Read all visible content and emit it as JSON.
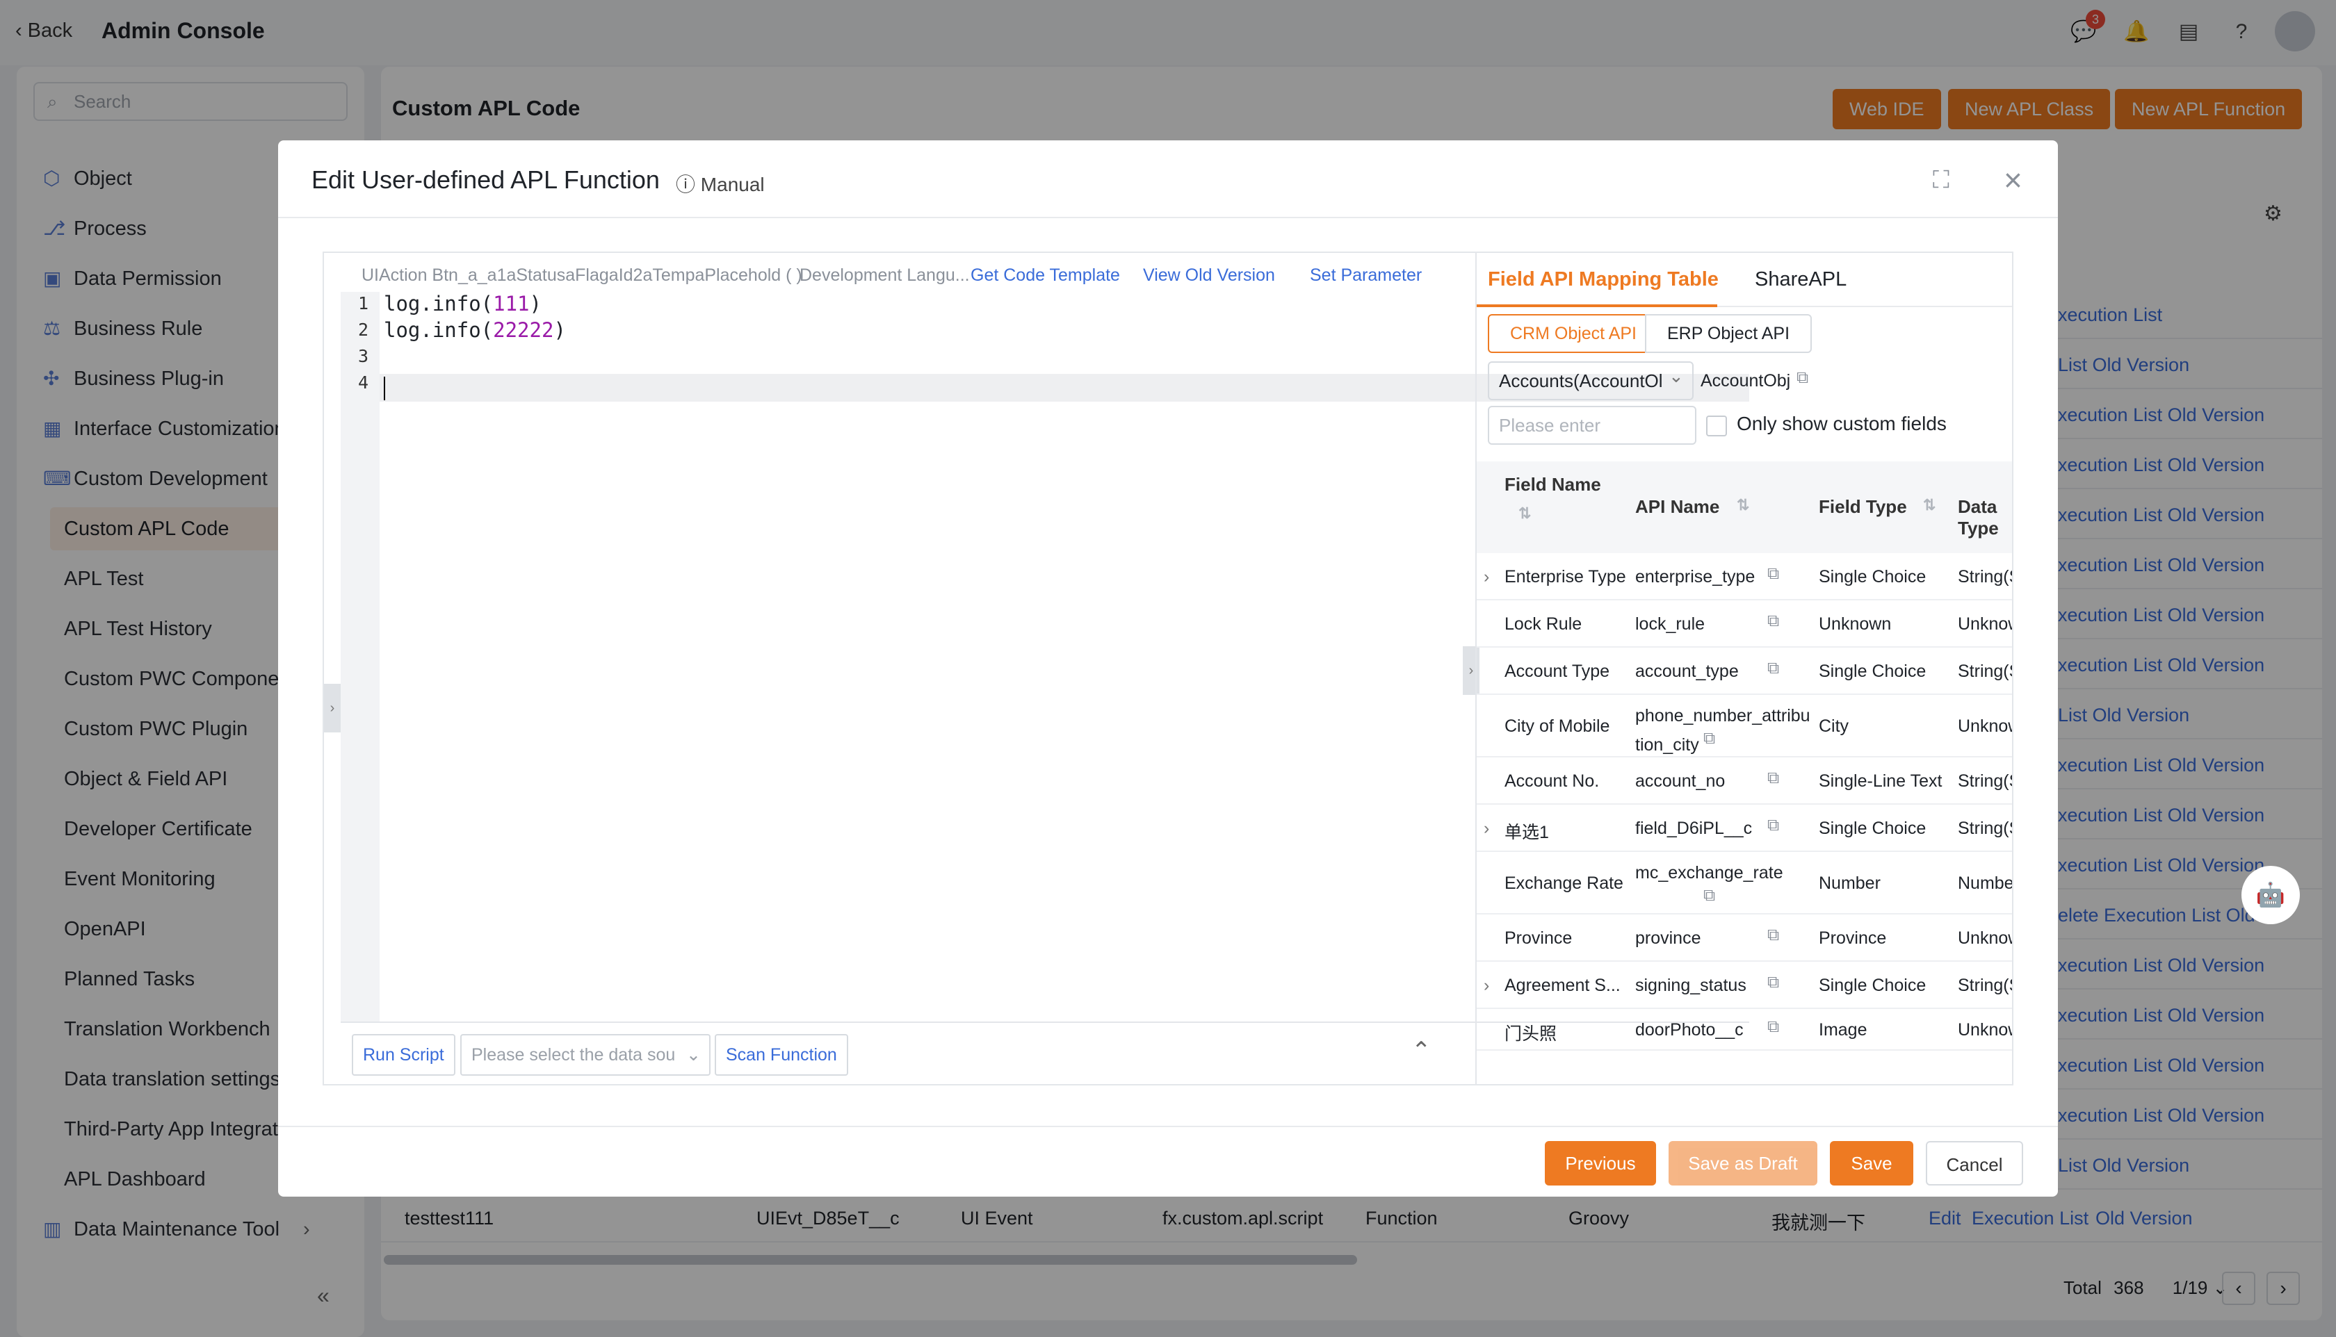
{
  "topbar": {
    "back_label": "Back",
    "title": "Admin Console",
    "chat_badge": "3",
    "icons": [
      "chat-icon",
      "bell-icon",
      "inbox-icon",
      "help-icon",
      "avatar"
    ]
  },
  "sidebar": {
    "search_placeholder": "Search",
    "items": [
      {
        "label": "Object",
        "icon": "cube-icon"
      },
      {
        "label": "Process",
        "icon": "flow-icon"
      },
      {
        "label": "Data Permission",
        "icon": "lock-icon"
      },
      {
        "label": "Business Rule",
        "icon": "rule-icon"
      },
      {
        "label": "Business Plug-in",
        "icon": "puzzle-icon"
      },
      {
        "label": "Interface Customization",
        "icon": "layout-icon"
      },
      {
        "label": "Custom Development",
        "icon": "code-icon"
      }
    ],
    "sub_items": [
      "Custom APL Code",
      "APL Test",
      "APL Test History",
      "Custom PWC Component",
      "Custom PWC Plugin",
      "Object & Field API",
      "Developer Certificate",
      "Event Monitoring",
      "OpenAPI",
      "Planned Tasks",
      "Translation Workbench",
      "Data translation settings",
      "Third-Party App Integration",
      "APL Dashboard"
    ],
    "last_item": {
      "label": "Data Maintenance Tool",
      "icon": "chart-icon"
    },
    "collapse": "«"
  },
  "main": {
    "title": "Custom APL Code",
    "buttons": [
      "Web IDE",
      "New APL Class",
      "New APL Function"
    ],
    "rows_actions": [
      "xecution List",
      "List  Old Version",
      "xecution List  Old Version",
      "xecution List  Old Version",
      "xecution List  Old Version",
      "xecution List  Old Version",
      "xecution List  Old Version",
      "xecution List  Old Version",
      "List  Old Version",
      "xecution List  Old Version",
      "xecution List  Old Version",
      "xecution List  Old Version",
      "elete  Execution List  Old ...",
      "xecution List  Old Version",
      "xecution List  Old Version",
      "xecution List  Old Version",
      "xecution List  Old Version",
      "List  Old Version"
    ],
    "last_row": {
      "name": "testtest111",
      "api": "UIEvt_D85eT__c",
      "type": "UI Event",
      "namespace": "fx.custom.apl.script",
      "kind": "Function",
      "lang": "Groovy",
      "remark": "我就测一下",
      "actions": [
        "Edit",
        "Execution List",
        "Old Version"
      ]
    },
    "pagination": {
      "total_label": "Total",
      "total": "368",
      "page": "1/19"
    }
  },
  "dialog": {
    "title": "Edit User-defined APL Function",
    "manual": "Manual",
    "toolbar": {
      "action": "UIAction Btn_a_a1aStatusaFlagaId2aTempaPlacehold ( )",
      "lang": "Development Langu...",
      "get_template": "Get Code Template",
      "old_version": "View Old Version",
      "set_param": "Set Parameter"
    },
    "code_lines": [
      "1",
      "2",
      "3",
      "4"
    ],
    "code": {
      "l1_fn": "log.info(",
      "l1_num": "111",
      "l1_end": ")",
      "l2_fn": "log.info(",
      "l2_num": "22222",
      "l2_end": ")"
    },
    "bottom": {
      "run": "Run Script",
      "select_placeholder": "Please select the data sou",
      "scan": "Scan Function"
    },
    "right": {
      "tabs": [
        "Field API Mapping Table",
        "ShareAPL"
      ],
      "segments": [
        "CRM Object API",
        "ERP Object API"
      ],
      "object_select": "Accounts(AccountOl",
      "object_api": "AccountObj",
      "filter_placeholder": "Please enter",
      "custom_only": "Only show custom fields",
      "columns": [
        "Field Name",
        "API Name",
        "Field Type",
        "Data Type"
      ],
      "rows": [
        {
          "name": "Enterprise Type",
          "api": "enterprise_type",
          "ftype": "Single Choice",
          "dtype": "String(String)",
          "expand": true
        },
        {
          "name": "Lock Rule",
          "api": "lock_rule",
          "ftype": "Unknown",
          "dtype": "Unknown",
          "expand": false
        },
        {
          "name": "Account Type",
          "api": "account_type",
          "ftype": "Single Choice",
          "dtype": "String(String)",
          "expand": false
        },
        {
          "name": "City of Mobile",
          "api": "phone_number_attribu tion_city",
          "ftype": "City",
          "dtype": "Unknown",
          "expand": false
        },
        {
          "name": "Account No.",
          "api": "account_no",
          "ftype": "Single-Line Text",
          "dtype": "String(String)",
          "expand": false
        },
        {
          "name": "单选1",
          "api": "field_D6iPL__c",
          "ftype": "Single Choice",
          "dtype": "String(String)",
          "expand": true
        },
        {
          "name": "Exchange Rate",
          "api": "mc_exchange_rate",
          "ftype": "Number",
          "dtype": "Number(Num",
          "expand": false
        },
        {
          "name": "Province",
          "api": "province",
          "ftype": "Province",
          "dtype": "Unknown",
          "expand": false
        },
        {
          "name": "Agreement S...",
          "api": "signing_status",
          "ftype": "Single Choice",
          "dtype": "String(String)",
          "expand": true
        },
        {
          "name": "门头照",
          "api": "doorPhoto__c",
          "ftype": "Image",
          "dtype": "Unknown",
          "expand": false
        }
      ]
    },
    "footer": {
      "previous": "Previous",
      "save_draft": "Save as Draft",
      "save": "Save",
      "cancel": "Cancel"
    }
  },
  "colors": {
    "accent": "#ee7a22",
    "link": "#3a6cd9"
  }
}
